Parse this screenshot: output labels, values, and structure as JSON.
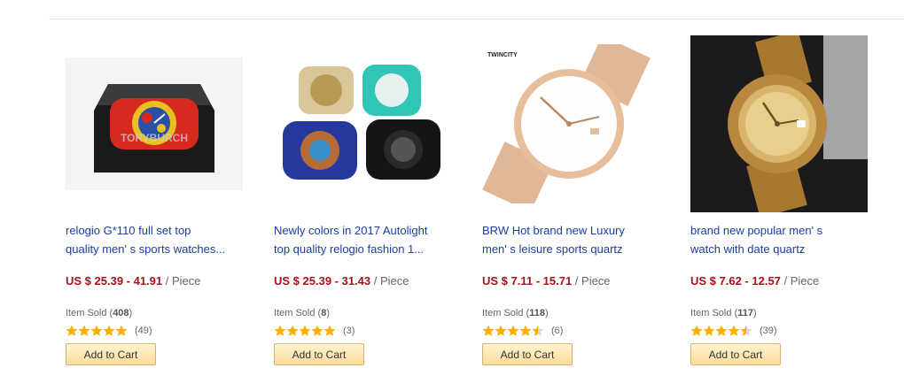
{
  "products": [
    {
      "brand_watermark": "TORYBURCH",
      "title_line1": "relogio G*110 full set top",
      "title_line2": "quality men' s sports watches...",
      "price": "US $ 25.39 - 41.91",
      "unit": " / Piece",
      "sold_label": "Item Sold (",
      "sold_count": "408",
      "sold_close": ")",
      "rating": 5,
      "review_count": "(49)",
      "cart_label": "Add to Cart"
    },
    {
      "title_line1": "Newly colors in 2017 Autolight",
      "title_line2": "top quality relogio fashion 1...",
      "price": "US $ 25.39 - 31.43",
      "unit": " / Piece",
      "sold_label": "Item Sold (",
      "sold_count": "8",
      "sold_close": ")",
      "rating": 5,
      "review_count": "(3)",
      "cart_label": "Add to Cart"
    },
    {
      "brand_logo": "TWINCITY",
      "title_line1": "BRW Hot brand new Luxury",
      "title_line2": "men' s leisure sports quartz",
      "price": "US $ 7.11 - 15.71",
      "unit": " / Piece",
      "sold_label": "Item Sold (",
      "sold_count": "118",
      "sold_close": ")",
      "rating": 4.5,
      "review_count": "(6)",
      "cart_label": "Add to Cart"
    },
    {
      "title_line1": "brand new popular men' s",
      "title_line2": "watch with date quartz",
      "price": "US $ 7.62 - 12.57",
      "unit": " / Piece",
      "sold_label": "Item Sold (",
      "sold_count": "117",
      "sold_close": ")",
      "rating": 4.5,
      "review_count": "(39)",
      "cart_label": "Add to Cart"
    }
  ],
  "colors": {
    "title": "#1a3ea0",
    "price": "#a8101a",
    "star": "#f5b000",
    "button_border": "#d8b270"
  }
}
